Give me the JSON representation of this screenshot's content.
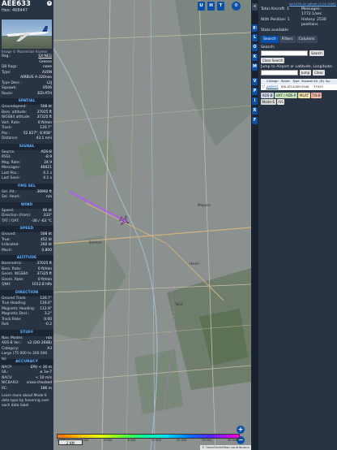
{
  "aircraft": {
    "callsign": "AEE633",
    "hex_label": "Hex:",
    "hex": "468447",
    "photo_credit": "Image © Maximilian Kramer",
    "close": "×"
  },
  "info_rows": [
    {
      "k": "Reg.:",
      "v": "SX-NEG",
      "link": true
    },
    {
      "k": "",
      "v": "Greece"
    },
    {
      "k": "DB flags:",
      "v": "none"
    },
    {
      "k": "Type:",
      "v": "A20N"
    },
    {
      "k": "",
      "v": "AIRBUS A-320neo"
    },
    {
      "k": "Type Desc.:",
      "v": "L2J"
    },
    {
      "k": "Squawk:",
      "v": "0506"
    },
    {
      "k": "Route:",
      "v": "EDI-ATH"
    }
  ],
  "sections": [
    {
      "title": "SPATIAL",
      "rows": [
        {
          "k": "Groundspeed:",
          "v": "508 kt"
        },
        {
          "k": "Baro. altitude:",
          "v": "37025 ft"
        },
        {
          "k": "WGS84 altitude:",
          "v": "37325 ft"
        },
        {
          "k": "Vert. Rate:",
          "v": "0 ft/min"
        },
        {
          "k": "Track:",
          "v": "120.7°"
        },
        {
          "k": "Pos.:",
          "v": "52.817°, 6.958°"
        },
        {
          "k": "Distance:",
          "v": "43.1 nmi"
        }
      ]
    },
    {
      "title": "SIGNAL",
      "rows": [
        {
          "k": "Source:",
          "v": "ADS-B"
        },
        {
          "k": "RSSI:",
          "v": "-8.9"
        },
        {
          "k": "Msg. Rate:",
          "v": "24.9"
        },
        {
          "k": "Messages:",
          "v": "48021"
        },
        {
          "k": "Last Pos.:",
          "v": "0.1 s"
        },
        {
          "k": "Last Seen:",
          "v": "0.1 s"
        }
      ]
    },
    {
      "title": "FMS SEL",
      "rows": [
        {
          "k": "Sel. Alt.:",
          "v": "36992 ft"
        },
        {
          "k": "Sel. Head.:",
          "v": "n/a"
        }
      ]
    },
    {
      "title": "WIND",
      "rows": [
        {
          "k": "Speed:",
          "v": "66 kt"
        },
        {
          "k": "Direction (from):",
          "v": "333°"
        },
        {
          "k": "TAT / OAT:",
          "v": "-36 / -63 °C"
        }
      ]
    },
    {
      "title": "SPEED",
      "rows": [
        {
          "k": "Ground:",
          "v": "508 kt"
        },
        {
          "k": "True:",
          "v": "452 kt"
        },
        {
          "k": "Indicated:",
          "v": "260 kt"
        },
        {
          "k": "Mach:",
          "v": "0.800"
        }
      ]
    },
    {
      "title": "ALTITUDE",
      "rows": [
        {
          "k": "Barometric:",
          "v": "37025 ft"
        },
        {
          "k": "Baro. Rate:",
          "v": "0 ft/min"
        },
        {
          "k": "Geom. WGS84:",
          "v": "37325 ft"
        },
        {
          "k": "Geom. Rate:",
          "v": "0 ft/min"
        },
        {
          "k": "QNH:",
          "v": "1012.8 hPa"
        }
      ]
    },
    {
      "title": "DIRECTION",
      "rows": [
        {
          "k": "Ground Track:",
          "v": "120.7°"
        },
        {
          "k": "True Heading:",
          "v": "116.0°"
        },
        {
          "k": "Magnetic Heading:",
          "v": "112.9°"
        },
        {
          "k": "Magnetic Decl.:",
          "v": "3.2°"
        },
        {
          "k": "Track Rate:",
          "v": "0.00"
        },
        {
          "k": "Roll:",
          "v": "-0.2"
        }
      ]
    },
    {
      "title": "STUFF",
      "rows": [
        {
          "k": "Nav. Modes:",
          "v": "n/a"
        },
        {
          "k": "ADS-B Ver.:",
          "v": "v2 (DO-260B)"
        },
        {
          "k": "Category:",
          "v": "A3"
        },
        {
          "k": "Large (75 000 to 300 000 lb)",
          "v": ""
        }
      ]
    },
    {
      "title": "ACCURACY",
      "rows": [
        {
          "k": "NACP:",
          "v": "EPU < 30 m"
        },
        {
          "k": "SIL:",
          "v": "≤ 1e-7"
        },
        {
          "k": "NACV:",
          "v": "< 10 m/s"
        },
        {
          "k": "NICBARO:",
          "v": "cross-checked"
        },
        {
          "k": "RC:",
          "v": "186 m"
        }
      ]
    }
  ],
  "footer_note": "Learn more about Mode-S data type by hovering over each data label.",
  "map": {
    "top_buttons": [
      "U",
      "H",
      "T"
    ],
    "side_buttons": [
      "L",
      "O",
      "K",
      "M",
      "V",
      "P",
      "I",
      "R",
      "F"
    ],
    "scale": "2 NM",
    "attribution": "© OpenStreetMap contributors",
    "zoom_in": "+",
    "zoom_out": "−",
    "alt_ticks": [
      "2 000",
      "4 000",
      "6 000",
      "8 000",
      "10 000",
      "20 000",
      "30 000",
      "40 000+"
    ],
    "town_labels": [
      "Emmen",
      "Meppen",
      "Haren",
      "Twist"
    ]
  },
  "sidebar": {
    "top_link": "tar1090 on github (3.14.1686)",
    "stats": [
      {
        "k": "Total Aircraft: 1",
        "v": "Messages: 1772.1/sec"
      },
      {
        "k": "With Position: 1",
        "v": "History: 2530 positions"
      },
      {
        "k": "Stats available",
        "v": ""
      }
    ],
    "tabs": [
      "Search",
      "Filters",
      "Columns"
    ],
    "search_label": "Search:",
    "search_button": "Search",
    "clear_search": "Clear Search",
    "jump_label": "Jump to Airport or Latitude, Longitude:",
    "jump_button": "Jump",
    "clear_button": "Clear",
    "table_headers": [
      "",
      "Callsign",
      "Route",
      "Type",
      "Squawk",
      "Alt. (ft)",
      "Sp."
    ],
    "table_rows": [
      [
        "🏳",
        "AEE633",
        "EDI-ATH",
        "A20N",
        "0506",
        "37025",
        ""
      ]
    ],
    "legend": [
      {
        "label": "ADS-B",
        "color": "#d0d8e6"
      },
      {
        "label": "UAT / ADS-R",
        "color": "#c4e6b8"
      },
      {
        "label": "MLAT",
        "color": "#f4e0a8"
      },
      {
        "label": "TIS-B",
        "color": "#f4b8a8"
      },
      {
        "label": "Mode-S",
        "color": "#d8d8d8"
      },
      {
        "label": "AIS",
        "color": "#e8e8e8"
      }
    ]
  },
  "colors": {
    "accent": "#0a4fa8",
    "section_title": "#5fb3ff",
    "track": "#b455ff",
    "aircraft": "#cc66ff"
  }
}
